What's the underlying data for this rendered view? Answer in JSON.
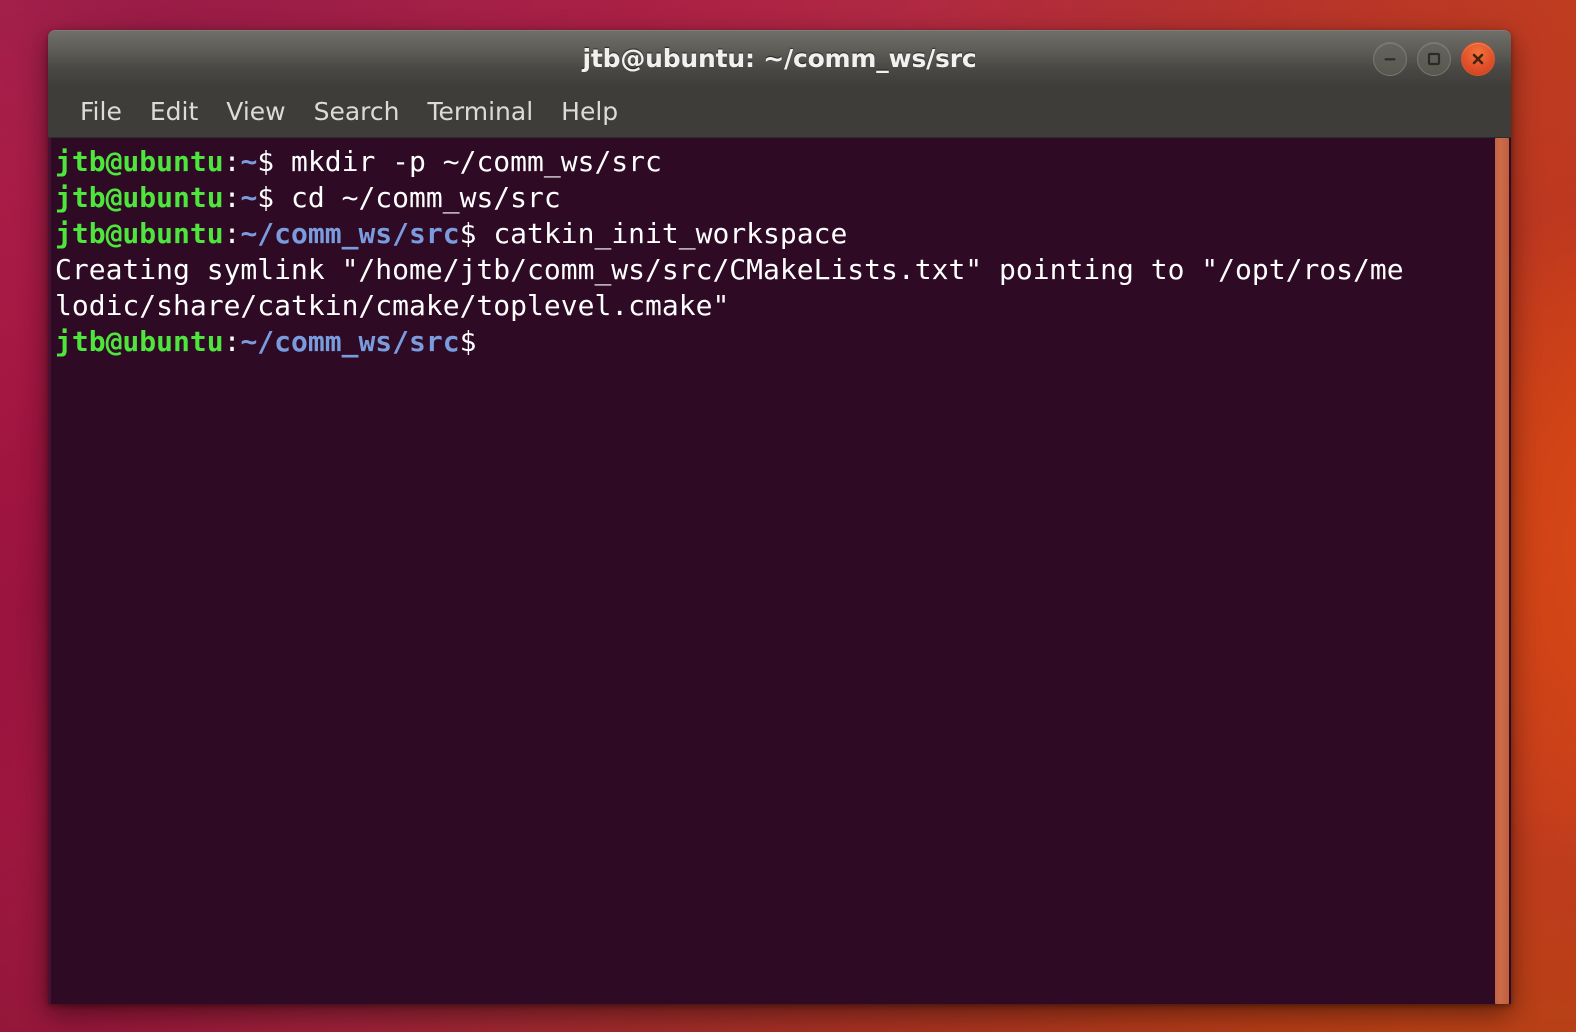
{
  "window": {
    "title": "jtb@ubuntu: ~/comm_ws/src",
    "controls": {
      "minimize_label": "minimize",
      "maximize_label": "maximize",
      "close_label": "close"
    }
  },
  "menubar": {
    "items": [
      {
        "label": "File"
      },
      {
        "label": "Edit"
      },
      {
        "label": "View"
      },
      {
        "label": "Search"
      },
      {
        "label": "Terminal"
      },
      {
        "label": "Help"
      }
    ]
  },
  "terminal": {
    "background_color": "#2e0a24",
    "prompt_user_color": "#4ee63c",
    "prompt_path_color": "#7a9cde",
    "text_color": "#ffffff",
    "lines": [
      {
        "type": "prompt",
        "user_host": "jtb@ubuntu",
        "sep": ":",
        "path": "~",
        "dollar": "$ ",
        "command": "mkdir -p ~/comm_ws/src"
      },
      {
        "type": "prompt",
        "user_host": "jtb@ubuntu",
        "sep": ":",
        "path": "~",
        "dollar": "$ ",
        "command": "cd ~/comm_ws/src"
      },
      {
        "type": "prompt",
        "user_host": "jtb@ubuntu",
        "sep": ":",
        "path": "~/comm_ws/src",
        "dollar": "$ ",
        "command": "catkin_init_workspace"
      },
      {
        "type": "output",
        "text": "Creating symlink \"/home/jtb/comm_ws/src/CMakeLists.txt\" pointing to \"/opt/ros/me"
      },
      {
        "type": "output",
        "text": "lodic/share/catkin/cmake/toplevel.cmake\""
      },
      {
        "type": "prompt",
        "user_host": "jtb@ubuntu",
        "sep": ":",
        "path": "~/comm_ws/src",
        "dollar": "$",
        "command": ""
      }
    ]
  },
  "scrollbar": {
    "thumb_color": "#c66a46",
    "position_percent": 100
  },
  "desktop": {
    "wallpaper_colors": [
      "#8e1440",
      "#b3302f",
      "#d04b17"
    ]
  }
}
